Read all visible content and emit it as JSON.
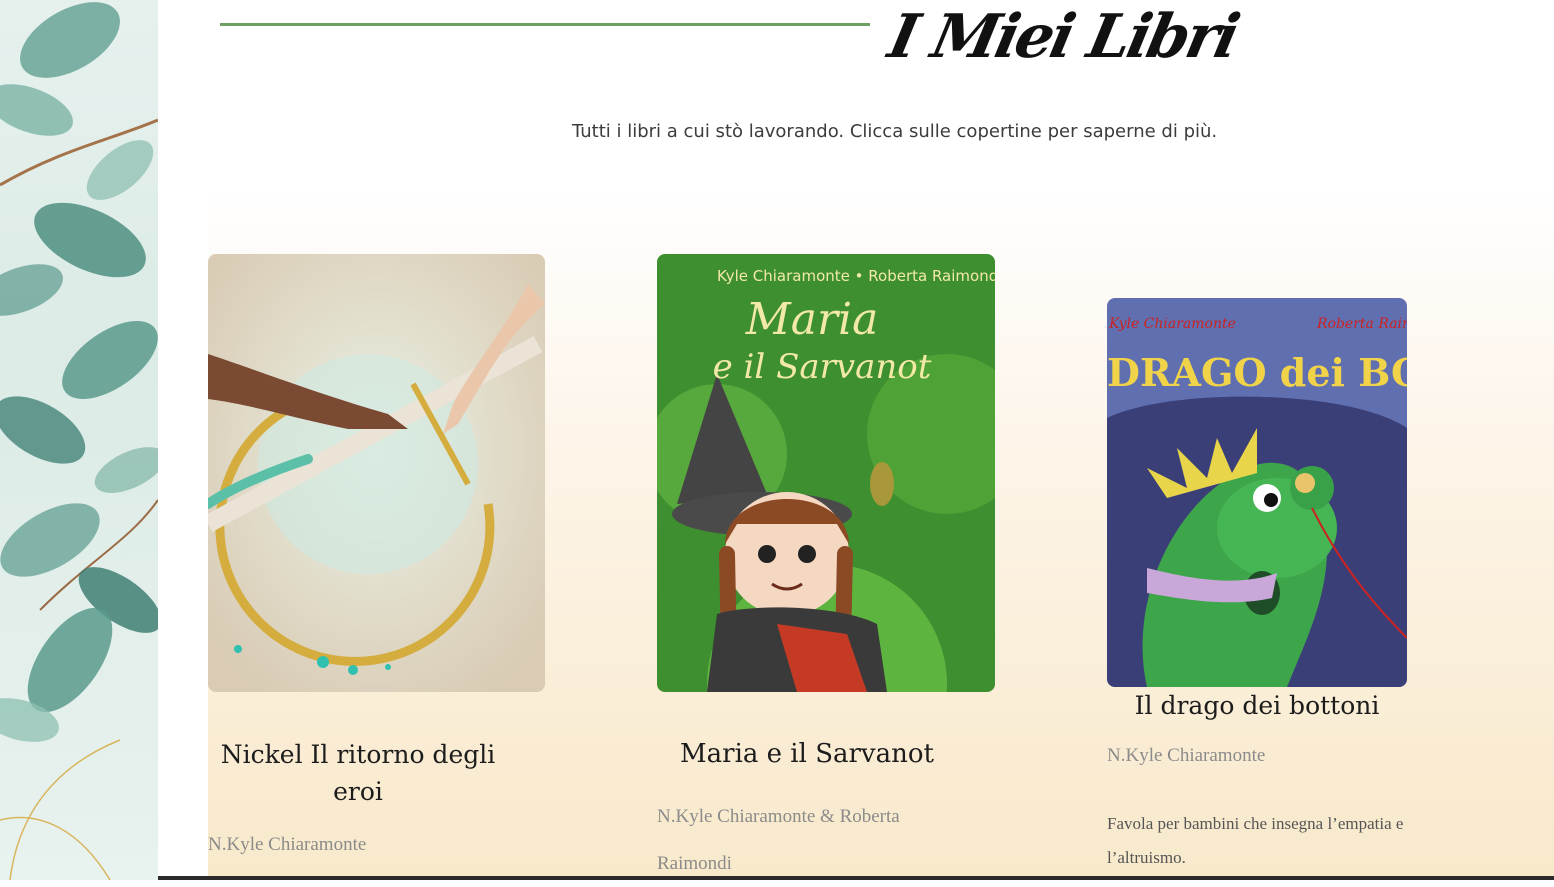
{
  "header": {
    "title": "I Miei Libri",
    "subtitle": "Tutti i libri a cui stò lavorando. Clicca sulle copertine per saperne di più."
  },
  "books": [
    {
      "title": "Nickel Il ritorno degli eroi",
      "author": "N.Kyle Chiaramonte",
      "cover_icon": "sword-and-hands-cover"
    },
    {
      "title": "Maria e il Sarvanot",
      "author": "N.Kyle Chiaramonte & Roberta Raimondi",
      "cover_authors": "Kyle Chiaramonte • Roberta Raimondi",
      "cover_title_line1": "Maria",
      "cover_title_line2": "e il Sarvanot"
    },
    {
      "title": "Il drago dei bottoni",
      "author": "N.Kyle Chiaramonte",
      "description": "Favola per bambini che insegna l’empatia e l’altruismo.",
      "cover_author_left": "Kyle Chiaramonte",
      "cover_author_right": "Roberta Raimondi",
      "cover_title": "DRAGO dei BOTTONI"
    }
  ],
  "colors": {
    "header_line": "#6ea064",
    "leaf_green": "#5f9c8e",
    "section_gradient_end": "#f8e9ca"
  }
}
